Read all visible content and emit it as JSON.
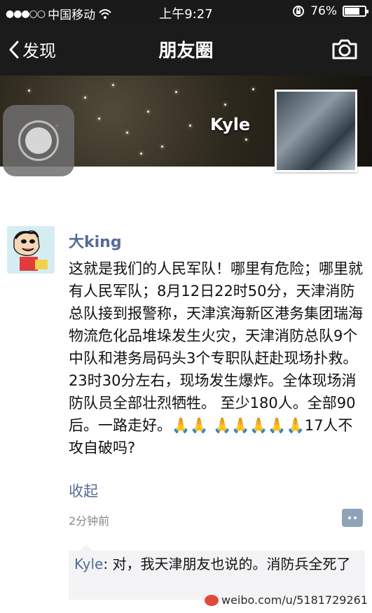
{
  "status_bar": {
    "signal_dots": "●●●○○",
    "carrier": "中国移动",
    "time": "上午9:27",
    "battery_text": "76%",
    "battery_level": 0.76
  },
  "nav": {
    "back_label": "发现",
    "title": "朋友圈"
  },
  "cover": {
    "name": "Kyle"
  },
  "post": {
    "username": "大king",
    "body": "这就是我们的人民军队！哪里有危险；哪里就有人民军队；8月12日22时50分，天津消防总队接到报警称，天津滨海新区港务集团瑞海物流危化品堆垛发生火灾，天津消防总队9个中队和港务局码头3个专职队赶赴现场扑救。23时30分左右，现场发生爆炸。全体现场消防队员全部壮烈牺牲。 至少180人。全部90后。一路走好。🙏🙏 🙏🙏🙏🙏🙏17人不攻自破吗?",
    "collapse_label": "收起",
    "time": "2分钟前"
  },
  "comment": {
    "author": "Kyle",
    "separator": ": ",
    "text": "对，我天津朋友也说的。消防兵全死了"
  },
  "watermark": {
    "text": "weibo.com/u/5181729261"
  }
}
